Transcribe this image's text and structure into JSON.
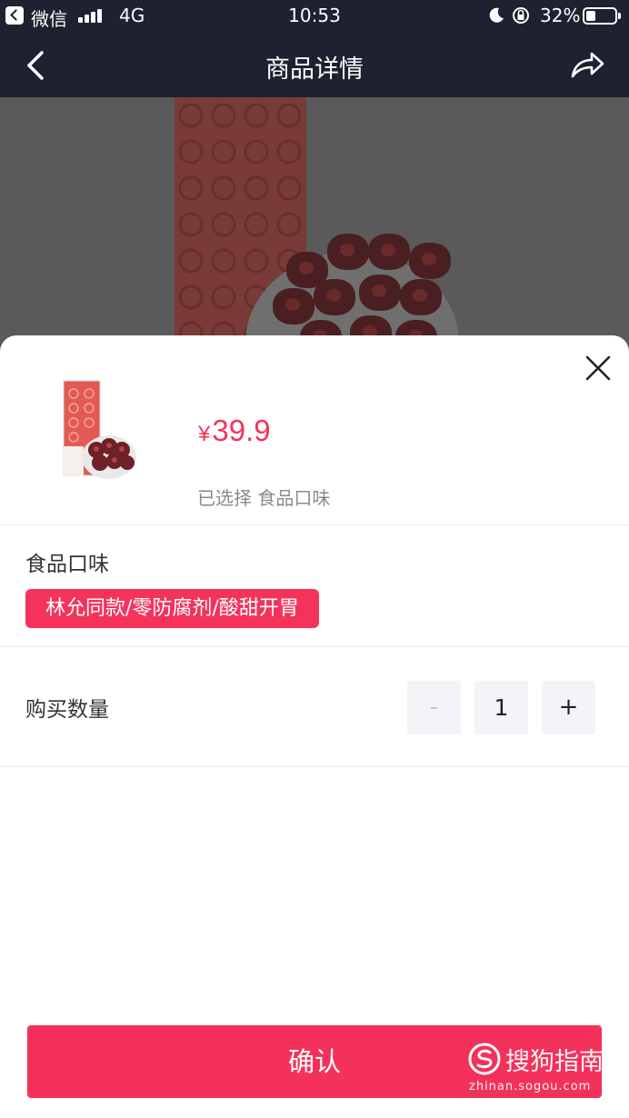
{
  "status_bar": {
    "carrier": "微信",
    "network": "4G",
    "time": "10:53",
    "battery_percent": "32%"
  },
  "nav": {
    "title": "商品详情"
  },
  "product": {
    "currency": "¥",
    "price": "39.9",
    "selected_text": "已选择 食品口味"
  },
  "flavor": {
    "label": "食品口味",
    "options": [
      "林允同款/零防腐剂/酸甜开胃"
    ],
    "selected_index": 0
  },
  "quantity": {
    "label": "购买数量",
    "minus": "-",
    "value": "1",
    "plus": "+"
  },
  "confirm_label": "确认",
  "watermark": {
    "name": "搜狗指南",
    "url": "zhinan.sogou.com"
  },
  "colors": {
    "accent": "#f5335a",
    "header_bg": "#1f2130"
  },
  "icons": [
    "back-app-icon",
    "signal-icon",
    "moon-icon",
    "rotation-lock-icon",
    "battery-icon",
    "back-arrow-icon",
    "share-icon",
    "close-icon",
    "sogou-logo-icon"
  ]
}
